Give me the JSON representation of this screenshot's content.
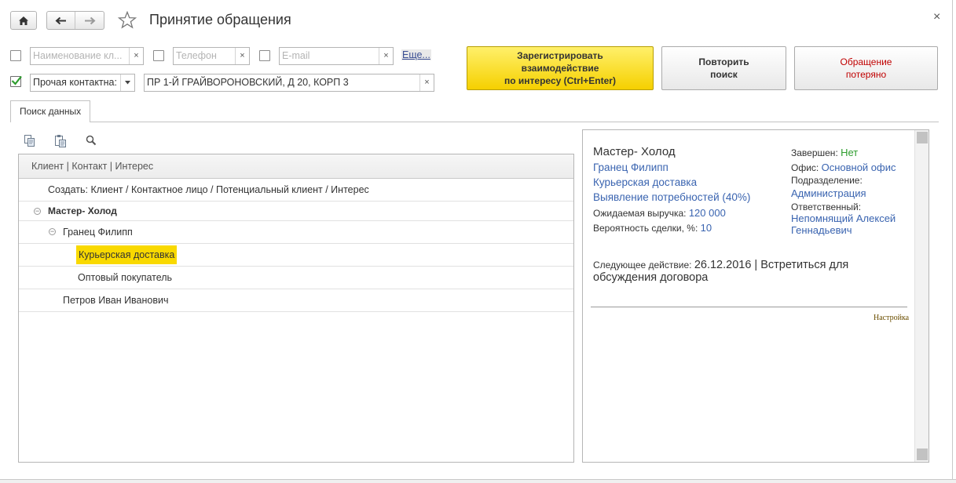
{
  "window": {
    "title": "Принятие обращения",
    "close_glyph": "×"
  },
  "nav": {
    "home_icon": "home-icon",
    "back_icon": "arrow-left-icon",
    "forward_icon": "arrow-right-icon",
    "favorite_icon": "star-icon"
  },
  "filters": {
    "client_name": {
      "checked": false,
      "placeholder": "Наименование кл...",
      "value": ""
    },
    "phone": {
      "checked": false,
      "placeholder": "Телефон",
      "value": ""
    },
    "email": {
      "checked": false,
      "placeholder": "E-mail",
      "value": ""
    },
    "more_link": "Еще...",
    "other_contact": {
      "checked": true,
      "type_value": "Прочая контактна:",
      "value": "ПР 1-Й ГРАЙВОРОНОВСКИЙ, Д 20, КОРП 3"
    },
    "clear_glyph": "×"
  },
  "actions": {
    "register_line1": "Зарегистрировать",
    "register_line2": "взаимодействие",
    "register_line3": "по интересу (Ctrl+Enter)",
    "repeat_line1": "Повторить",
    "repeat_line2": "поиск",
    "lost_line1": "Обращение",
    "lost_line2": "потеряно"
  },
  "tabs": [
    {
      "label": "Поиск данных",
      "active": true
    }
  ],
  "tree": {
    "header": "Клиент | Контакт | Интерес",
    "rows": [
      {
        "text": "Создать: Клиент / Контактное лицо / Потенциальный клиент / Интерес",
        "level": 0,
        "bold": false
      },
      {
        "text": "Мастер- Холод",
        "level": 0,
        "bold": true,
        "expanded": true
      },
      {
        "text": "Гранец Филипп",
        "level": 1,
        "bold": false,
        "expanded": true
      },
      {
        "text": "Курьерская доставка",
        "level": 2,
        "bold": false,
        "selected": true
      },
      {
        "text": "Оптовый покупатель",
        "level": 2,
        "bold": false
      },
      {
        "text": "Петров Иван Иванович",
        "level": 1,
        "bold": false
      }
    ]
  },
  "detail": {
    "client_name": "Мастер- Холод",
    "contact": "Гранец Филипп",
    "interest": "Курьерская доставка",
    "stage": "Выявление потребностей (40%)",
    "expected_revenue_label": "Ожидаемая выручка:",
    "expected_revenue_value": "120 000",
    "probability_label": "Вероятность сделки, %:",
    "probability_value": "10",
    "completed_label": "Завершен:",
    "completed_value": "Нет",
    "office_label": "Офис:",
    "office_value": "Основной офис",
    "department_label": "Подразделение:",
    "department_value": "Администрация",
    "responsible_label": "Ответственный:",
    "responsible_value_line1": "Непомнящий Алексей",
    "responsible_value_line2": "Геннадьевич",
    "next_action_label": "Следующее действие:",
    "next_action_line1": "26.12.2016 | Встретиться для",
    "next_action_line2": "обсуждения договора",
    "settings_link": "Настройка"
  },
  "colors": {
    "primary_button": "#f5d000",
    "highlight": "#f9d900",
    "link": "#3a64b0",
    "status_green": "#2e9d2e",
    "lost_red": "#c00000"
  }
}
